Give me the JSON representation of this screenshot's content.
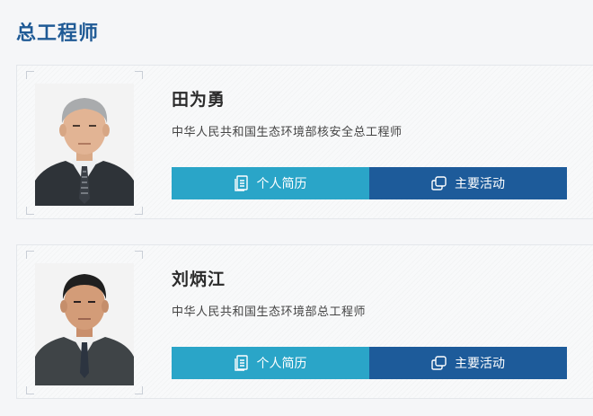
{
  "section": {
    "title": "总工程师"
  },
  "people": [
    {
      "name": "田为勇",
      "position": "中华人民共和国生态环境部核安全总工程师",
      "buttons": {
        "resume": "个人简历",
        "activities": "主要活动"
      }
    },
    {
      "name": "刘炳江",
      "position": "中华人民共和国生态环境部总工程师",
      "buttons": {
        "resume": "个人简历",
        "activities": "主要活动"
      }
    }
  ],
  "icons": {
    "resume": "document-icon",
    "activities": "copy-window-icon"
  },
  "colors": {
    "title": "#1f5a95",
    "resume_button": "#2aa5c8",
    "activities_button": "#1d5b9a",
    "page_background": "#f5f6f8"
  }
}
